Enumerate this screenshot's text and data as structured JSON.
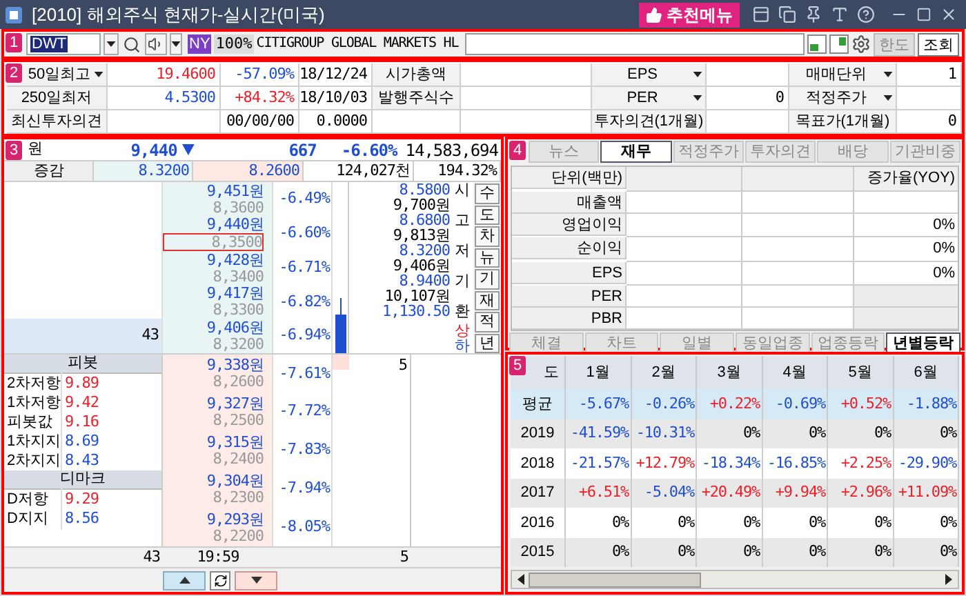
{
  "window": {
    "title": "[2010] 해외주식 현재가-실시간(미국)",
    "menu_button": "추천메뉴"
  },
  "toolbar": {
    "badge": "1",
    "symbol": "DWT",
    "exchange": "NY",
    "ratio": "100%",
    "name": "CITIGROUP GLOBAL MARKETS HL",
    "buttons": [
      {
        "label": "한도",
        "disabled": true
      },
      {
        "label": "조회",
        "disabled": false
      }
    ]
  },
  "stats": {
    "badge": "2",
    "rows": [
      [
        {
          "kind": "select",
          "text": "50일최고"
        },
        {
          "kind": "num",
          "text": "19.4600",
          "color": "#e8202a"
        },
        {
          "kind": "num",
          "text": "-57.09%",
          "color": "#1f4fd0"
        },
        {
          "kind": "num",
          "text": "18/12/24"
        },
        {
          "kind": "head",
          "text": "시가총액"
        },
        {
          "kind": "num"
        },
        {
          "kind": "select",
          "text": "EPS"
        },
        {
          "kind": "num"
        },
        {
          "kind": "select",
          "text": "매매단위"
        },
        {
          "kind": "num",
          "text": "1"
        }
      ],
      [
        {
          "kind": "head",
          "text": "250일최저"
        },
        {
          "kind": "num",
          "text": "4.5300",
          "color": "#1f4fd0"
        },
        {
          "kind": "num",
          "text": "+84.32%",
          "color": "#e8202a"
        },
        {
          "kind": "num",
          "text": "18/10/03"
        },
        {
          "kind": "head",
          "text": "발행주식수"
        },
        {
          "kind": "num"
        },
        {
          "kind": "select",
          "text": "PER"
        },
        {
          "kind": "num",
          "text": "0"
        },
        {
          "kind": "select",
          "text": "적정주가"
        },
        {
          "kind": "num"
        }
      ],
      [
        {
          "kind": "head",
          "text": "최신투자의견"
        },
        {
          "kind": "num"
        },
        {
          "kind": "num",
          "text": "00/00/00"
        },
        {
          "kind": "num",
          "text": "0.0000"
        },
        {
          "kind": "num"
        },
        {
          "kind": "num"
        },
        {
          "kind": "head",
          "text": "투자의견(1개월)"
        },
        {
          "kind": "num"
        },
        {
          "kind": "head",
          "text": "목표가(1개월)"
        },
        {
          "kind": "num",
          "text": "0"
        }
      ]
    ]
  },
  "order_book": {
    "badge": "3",
    "quote": {
      "label": "원",
      "price": "9,440",
      "falling": true,
      "change": "667",
      "rate": "-6.60%",
      "volume": "14,583,694"
    },
    "compare": {
      "label": "증감",
      "values": [
        "8.3200",
        "8.2600",
        "124,027천",
        "194.32%"
      ]
    },
    "asks": [
      {
        "krw": "9,451원",
        "usd": "8,3600",
        "rate": "-6.49%",
        "selected": false
      },
      {
        "krw": "9,440원",
        "usd": "8,3500",
        "rate": "-6.60%",
        "selected": true
      },
      {
        "krw": "9,428원",
        "usd": "8,3400",
        "rate": "-6.71%",
        "selected": false
      },
      {
        "krw": "9,417원",
        "usd": "8,3300",
        "rate": "-6.82%",
        "selected": false
      },
      {
        "krw": "9,406원",
        "usd": "8,3200",
        "rate": "-6.94%",
        "selected": false,
        "qty": "43"
      }
    ],
    "price_info": [
      {
        "label": "시",
        "value": "8.5800",
        "krw": "9,700원"
      },
      {
        "label": "고",
        "value": "8.6800",
        "krw": "9,813원"
      },
      {
        "label": "저",
        "value": "8.3200",
        "krw": "9,406원"
      },
      {
        "label": "기",
        "value": "8.9400",
        "krw": "10,107원"
      },
      {
        "label": "환",
        "value": "1,130.50"
      }
    ],
    "limits": [
      {
        "label": "상",
        "color": "#e8202a"
      },
      {
        "label": "하",
        "color": "#1f4fd0"
      }
    ],
    "side_buttons": [
      "수",
      "도",
      "차",
      "뉴",
      "기",
      "재",
      "적",
      "년"
    ],
    "bids": [
      {
        "krw": "9,338원",
        "usd": "8,2600",
        "rate": "-7.61%",
        "qty": "5"
      },
      {
        "krw": "9,327원",
        "usd": "8,2500",
        "rate": "-7.72%"
      },
      {
        "krw": "9,315원",
        "usd": "8,2400",
        "rate": "-7.83%"
      },
      {
        "krw": "9,304원",
        "usd": "8,2300",
        "rate": "-7.94%"
      },
      {
        "krw": "9,293원",
        "usd": "8,2200",
        "rate": "-8.05%"
      }
    ],
    "pivot": {
      "title": "피봇",
      "rows": [
        {
          "label": "2차저항",
          "value": "9.89",
          "color": "#e8202a"
        },
        {
          "label": "1차저항",
          "value": "9.42",
          "color": "#e8202a"
        },
        {
          "label": "피봇값",
          "value": "9.16",
          "color": "#e8202a"
        },
        {
          "label": "1차지지",
          "value": "8.69",
          "color": "#1f4fd0"
        },
        {
          "label": "2차지지",
          "value": "8.43",
          "color": "#1f4fd0"
        }
      ]
    },
    "demark": {
      "title": "디마크",
      "rows": [
        {
          "label": "D저항",
          "value": "9.29",
          "color": "#e8202a"
        },
        {
          "label": "D지지",
          "value": "8.56",
          "color": "#1f4fd0"
        }
      ]
    },
    "totals": {
      "ask_qty": "43",
      "time": "19:59",
      "bid_qty": "5"
    }
  },
  "finance": {
    "badge": "4",
    "tabs": [
      {
        "label": "뉴스",
        "selected": false
      },
      {
        "label": "재무",
        "selected": true
      },
      {
        "label": "적정주가",
        "selected": false
      },
      {
        "label": "투자의견",
        "selected": false
      },
      {
        "label": "배당",
        "selected": false
      },
      {
        "label": "기관비중",
        "selected": false
      }
    ],
    "columns": [
      "단위(백만)",
      "증가율(YOY)"
    ],
    "rows": [
      {
        "label": "매출액",
        "disabled": false
      },
      {
        "label": "영업이익",
        "yoy": "0%",
        "disabled": false
      },
      {
        "label": "순이익",
        "yoy": "0%",
        "disabled": false
      },
      {
        "label": "EPS",
        "yoy": "0%",
        "disabled": false
      },
      {
        "label": "PER",
        "disabled": true
      },
      {
        "label": "PBR",
        "disabled": true
      }
    ],
    "bottom_tabs": [
      {
        "label": "체결",
        "selected": false
      },
      {
        "label": "차트",
        "selected": false
      },
      {
        "label": "일별",
        "selected": false
      },
      {
        "label": "동일업종",
        "selected": false
      },
      {
        "label": "업종등락",
        "selected": false
      },
      {
        "label": "년별등락",
        "selected": true
      }
    ]
  },
  "yearly": {
    "badge": "5",
    "columns": [
      "도",
      "1월",
      "2월",
      "3월",
      "4월",
      "5월",
      "6월"
    ],
    "rows": [
      {
        "kind": "average",
        "cells": [
          {
            "text": "평균"
          },
          {
            "text": "-5.67%",
            "color": "#1f4fd0"
          },
          {
            "text": "-0.26%",
            "color": "#1f4fd0"
          },
          {
            "text": "+0.22%",
            "color": "#e8202a"
          },
          {
            "text": "-0.69%",
            "color": "#1f4fd0"
          },
          {
            "text": "+0.52%",
            "color": "#e8202a"
          },
          {
            "text": "-1.88%",
            "color": "#1f4fd0"
          }
        ]
      },
      {
        "kind": "year",
        "cells": [
          {
            "text": "2019"
          },
          {
            "text": "-41.59%",
            "color": "#1f4fd0"
          },
          {
            "text": "-10.31%",
            "color": "#1f4fd0"
          },
          {
            "text": "0%"
          },
          {
            "text": "0%"
          },
          {
            "text": "0%"
          },
          {
            "text": "0%"
          }
        ]
      },
      {
        "kind": "year",
        "cells": [
          {
            "text": "2018"
          },
          {
            "text": "-21.57%",
            "color": "#1f4fd0"
          },
          {
            "text": "+12.79%",
            "color": "#e8202a"
          },
          {
            "text": "-18.34%",
            "color": "#1f4fd0"
          },
          {
            "text": "-16.85%",
            "color": "#1f4fd0"
          },
          {
            "text": "+2.25%",
            "color": "#e8202a"
          },
          {
            "text": "-29.90%",
            "color": "#1f4fd0"
          }
        ]
      },
      {
        "kind": "year",
        "cells": [
          {
            "text": "2017"
          },
          {
            "text": "+6.51%",
            "color": "#e8202a"
          },
          {
            "text": "-5.04%",
            "color": "#1f4fd0"
          },
          {
            "text": "+20.49%",
            "color": "#e8202a"
          },
          {
            "text": "+9.94%",
            "color": "#e8202a"
          },
          {
            "text": "+2.96%",
            "color": "#e8202a"
          },
          {
            "text": "+11.09%",
            "color": "#e8202a"
          }
        ]
      },
      {
        "kind": "year",
        "cells": [
          {
            "text": "2016"
          },
          {
            "text": "0%"
          },
          {
            "text": "0%"
          },
          {
            "text": "0%"
          },
          {
            "text": "0%"
          },
          {
            "text": "0%"
          },
          {
            "text": "0%"
          }
        ]
      },
      {
        "kind": "year",
        "cells": [
          {
            "text": "2015"
          },
          {
            "text": "0%"
          },
          {
            "text": "0%"
          },
          {
            "text": "0%"
          },
          {
            "text": "0%"
          },
          {
            "text": "0%"
          },
          {
            "text": "0%"
          }
        ]
      }
    ]
  }
}
